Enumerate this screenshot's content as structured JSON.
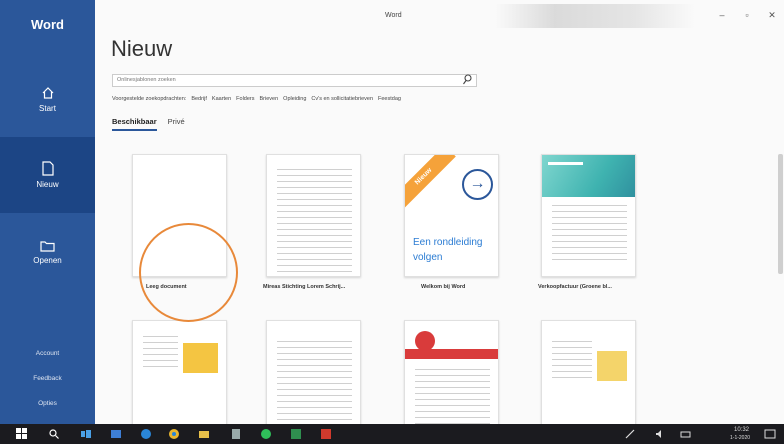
{
  "window": {
    "title": "Word"
  },
  "sidebar": {
    "brand": "Word",
    "items": [
      {
        "label": "Start",
        "icon": "home-icon"
      },
      {
        "label": "Nieuw",
        "icon": "new-document-icon"
      },
      {
        "label": "Openen",
        "icon": "folder-icon"
      }
    ],
    "footer": [
      "Account",
      "Feedback",
      "Opties"
    ]
  },
  "main": {
    "heading": "Nieuw",
    "search": {
      "placeholder": "Onlinesjablonen zoeken"
    },
    "suggested": [
      "Voorgestelde zoekopdrachten:",
      "Bedrijf",
      "Kaarten",
      "Folders",
      "Brieven",
      "Opleiding",
      "Cv's en sollicitatiebrieven",
      "Feestdag"
    ],
    "tabs": [
      {
        "label": "Beschikbaar",
        "active": true
      },
      {
        "label": "Privé",
        "active": false
      }
    ],
    "templates": [
      {
        "label": "Leeg document"
      },
      {
        "label": "Mireas Stichting Lorem Schrij..."
      },
      {
        "label": "Welkom bij Word",
        "badge": "Nieuw",
        "text": "Een rondleiding volgen"
      },
      {
        "label": "Verkoopfactuur (Groene bl..."
      }
    ]
  },
  "colors": {
    "accent": "#2b579a",
    "selected": "#1c4585",
    "highlight": "#e8893a",
    "badge": "#f5a23a"
  },
  "taskbar": {
    "time": "10:32",
    "date": "1-1-2020"
  }
}
